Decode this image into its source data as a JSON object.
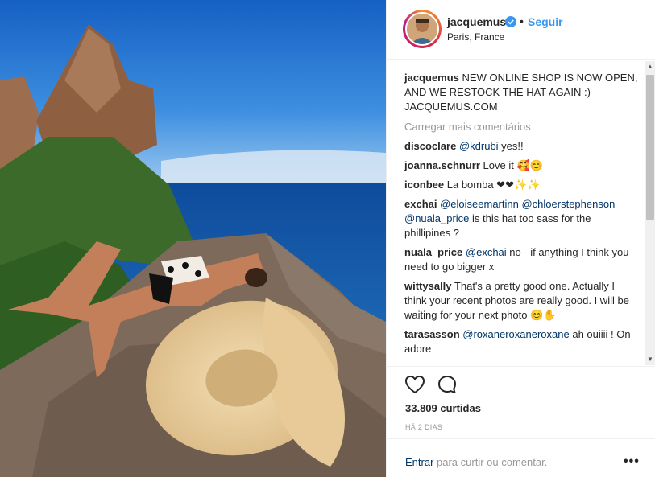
{
  "post": {
    "username": "jacquemus",
    "dot": "•",
    "follow_label": "Seguir",
    "location": "Paris, France",
    "caption": {
      "username": "jacquemus",
      "text": "NEW ONLINE SHOP IS NOW OPEN, AND WE RESTOCK THE HAT AGAIN :) JACQUEMUS.COM"
    },
    "load_more": "Carregar mais comentários",
    "comments": [
      {
        "user": "discoclare",
        "mention": "@kdrubi",
        "text": " yes!!"
      },
      {
        "user": "joanna.schnurr",
        "mention": "",
        "text": "Love it 🥰😊"
      },
      {
        "user": "iconbee",
        "mention": "",
        "text": "La bomba ❤❤✨✨"
      },
      {
        "user": "exchai",
        "mention": "@eloiseemartinn",
        "mention2": "@chloerstephenson",
        "mention3": "@nuala_price",
        "text": " is this hat too sass for the phillipines ?"
      },
      {
        "user": "nuala_price",
        "mention": "@exchai",
        "text": " no - if anything I think you need to go bigger x"
      },
      {
        "user": "wittysally",
        "mention": "",
        "text": "That's a pretty good one. Actually I think your recent photos are really good. I will be waiting for your next photo 😊✋"
      },
      {
        "user": "tarasasson",
        "mention": "@roxaneroxaneroxane",
        "text": " ah ouiiii ! On adore"
      }
    ],
    "likes": "33.809 curtidas",
    "time": "HÁ 2 DIAS",
    "footer": {
      "login_link": "Entrar",
      "login_text": " para curtir ou comentar.",
      "more": "•••"
    }
  },
  "icons": {
    "verified": "verified-badge-icon",
    "like": "heart-icon",
    "comment": "comment-bubble-icon",
    "more": "more-options-icon"
  },
  "colors": {
    "link": "#3897f0",
    "mention": "#003569",
    "muted": "#999999",
    "text": "#262626"
  }
}
